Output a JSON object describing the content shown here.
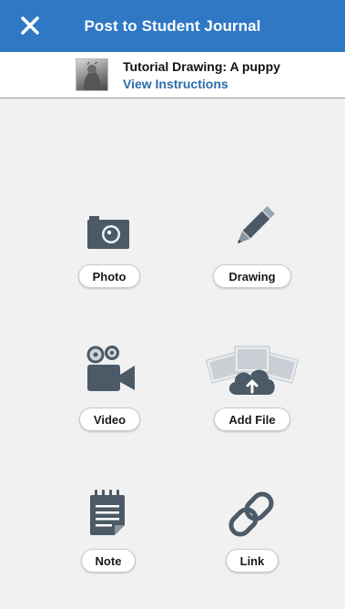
{
  "header": {
    "title": "Post to Student Journal",
    "close_icon": "close-icon",
    "bg_color": "#2f78c4"
  },
  "assignment": {
    "title": "Tutorial Drawing: A puppy",
    "link_label": "View Instructions"
  },
  "options": {
    "photo": {
      "label": "Photo",
      "icon": "camera-icon"
    },
    "drawing": {
      "label": "Drawing",
      "icon": "pencil-icon"
    },
    "video": {
      "label": "Video",
      "icon": "video-camera-icon"
    },
    "add_file": {
      "label": "Add File",
      "icon": "cloud-upload-icon"
    },
    "note": {
      "label": "Note",
      "icon": "notepad-icon"
    },
    "link": {
      "label": "Link",
      "icon": "chain-link-icon"
    }
  },
  "colors": {
    "icon": "#4b5a66",
    "link": "#2a6eaa"
  }
}
